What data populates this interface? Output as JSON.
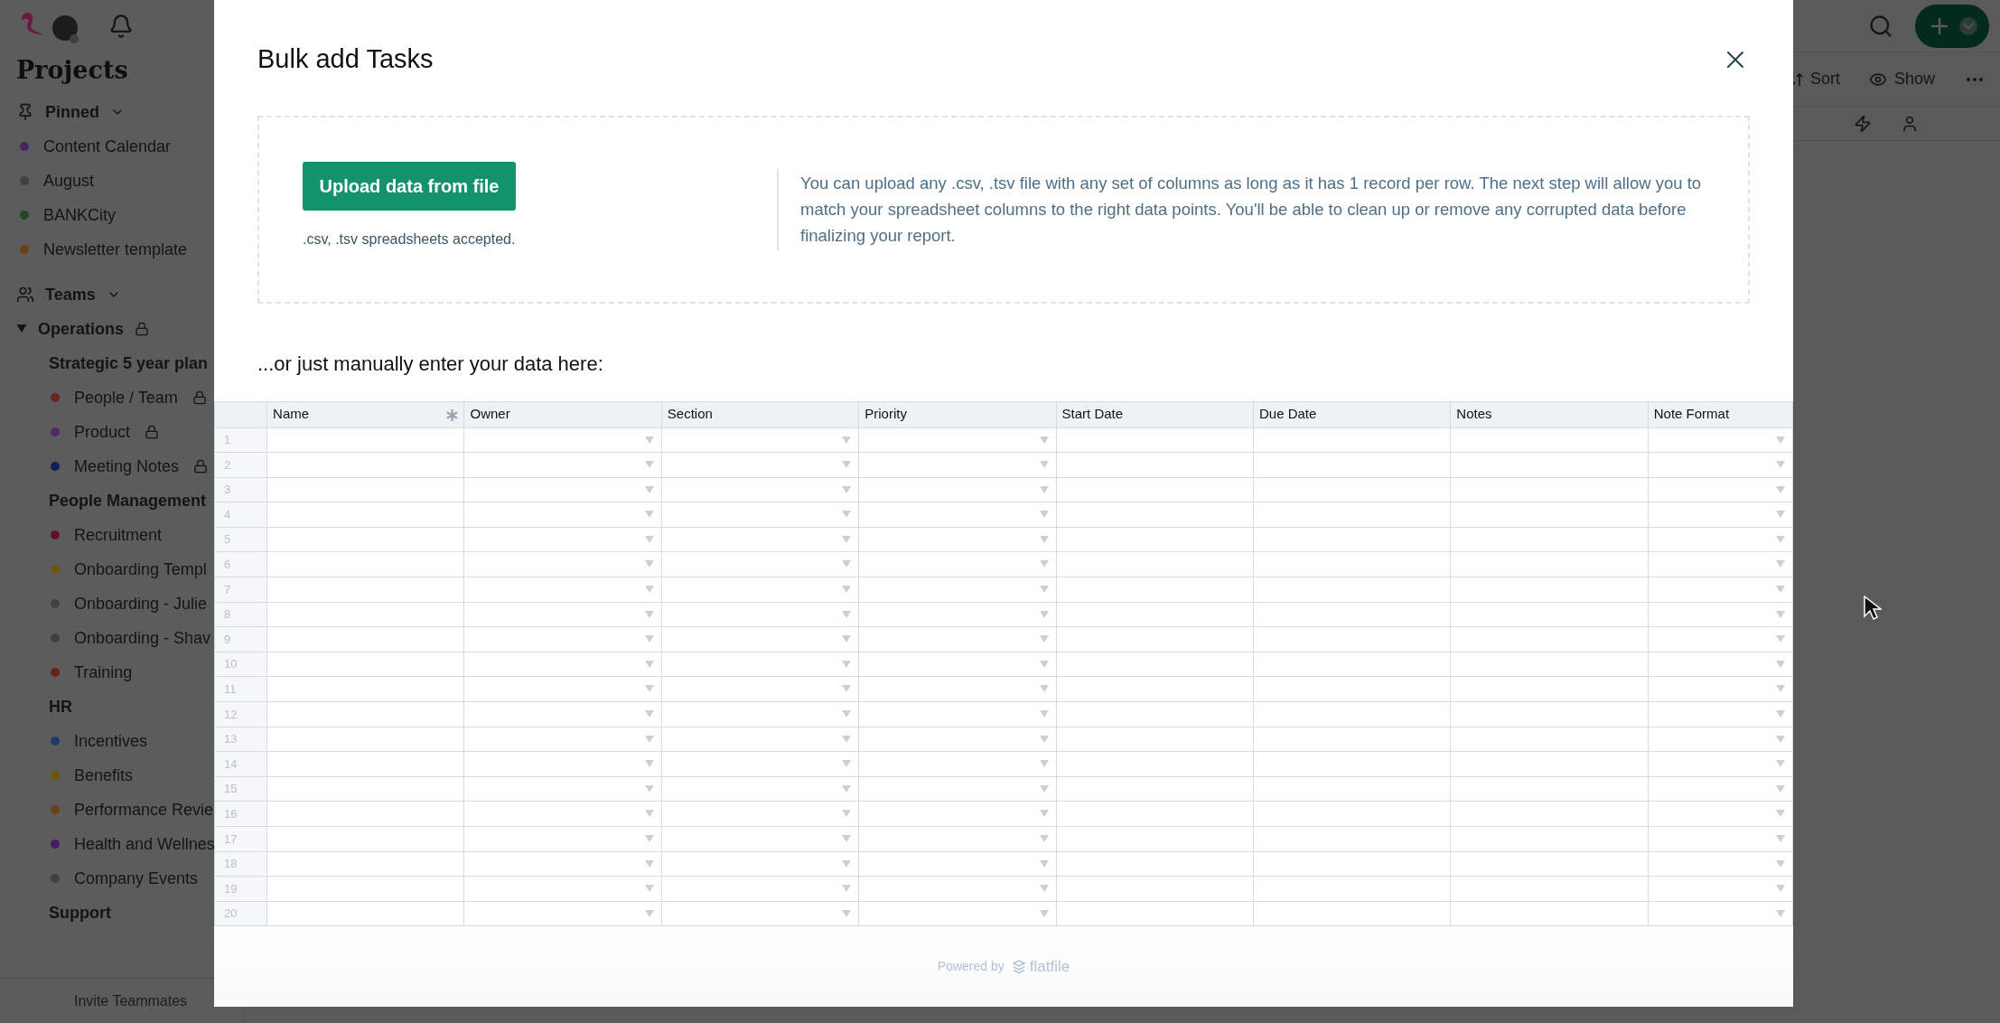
{
  "topbar": {
    "sort": "Sort",
    "show": "Show"
  },
  "sidebar": {
    "title": "Projects",
    "pinned": {
      "label": "Pinned",
      "items": [
        {
          "name": "Content Calendar",
          "color": "#4a2566"
        },
        {
          "name": "August",
          "color": "#404040"
        },
        {
          "name": "BANKCity",
          "color": "#1d4a22"
        },
        {
          "name": "Newsletter template",
          "color": "#6e4018"
        }
      ]
    },
    "teams": {
      "label": "Teams",
      "groups": [
        {
          "name": "Operations",
          "locked": true,
          "expanded": true,
          "children": [
            {
              "name": "Strategic 5 year plan",
              "children": [
                {
                  "name": "People / Team",
                  "color": "#6e2320",
                  "locked": true
                },
                {
                  "name": "Product",
                  "color": "#4f2a6a",
                  "locked": true
                },
                {
                  "name": "Meeting Notes",
                  "color": "#141c5c",
                  "locked": true
                }
              ]
            },
            {
              "name": "People Management",
              "children": [
                {
                  "name": "Recruitment",
                  "color": "#641128",
                  "locked": false
                },
                {
                  "name": "Onboarding Templ",
                  "color": "#6b5616"
                },
                {
                  "name": "Onboarding - Julie",
                  "color": "#404040"
                },
                {
                  "name": "Onboarding - Shav",
                  "color": "#404040"
                },
                {
                  "name": "Training",
                  "color": "#6b1f1a",
                  "locked": false
                }
              ]
            },
            {
              "name": "HR",
              "children": [
                {
                  "name": "Incentives",
                  "color": "#1c3d70",
                  "locked": false
                },
                {
                  "name": "Benefits",
                  "color": "#6e5508",
                  "locked": false
                },
                {
                  "name": "Performance Revie",
                  "color": "#6e4018"
                },
                {
                  "name": "Health and Wellnes",
                  "color": "#4a1a6e"
                },
                {
                  "name": "Company Events",
                  "color": "#404040",
                  "locked": false
                }
              ]
            },
            {
              "name": "Support"
            }
          ]
        }
      ]
    },
    "invite": "Invite Teammates"
  },
  "dialog": {
    "title": "Bulk add Tasks",
    "upload": {
      "button": "Upload data from file",
      "hint": ".csv, .tsv spreadsheets accepted.",
      "description": "You can upload any .csv, .tsv file with any set of columns as long as it has 1 record per row. The next step will allow you to match your spreadsheet columns to the right data points. You'll be able to clean up or remove any corrupted data before finalizing your report."
    },
    "manual_label": "...or just manually enter your data here:",
    "table": {
      "columns": [
        {
          "label": "Name",
          "kind": "text",
          "required": true
        },
        {
          "label": "Owner",
          "kind": "select",
          "required": false
        },
        {
          "label": "Section",
          "kind": "select",
          "required": false
        },
        {
          "label": "Priority",
          "kind": "select",
          "required": false
        },
        {
          "label": "Start Date",
          "kind": "text",
          "required": false
        },
        {
          "label": "Due Date",
          "kind": "text",
          "required": false
        },
        {
          "label": "Notes",
          "kind": "text",
          "required": false
        },
        {
          "label": "Note Format",
          "kind": "select",
          "required": false
        }
      ],
      "rows": [
        "1",
        "2",
        "3",
        "4",
        "5",
        "6",
        "7",
        "8",
        "9",
        "10",
        "11",
        "12",
        "13",
        "14",
        "15",
        "16",
        "17",
        "18",
        "19",
        "20"
      ]
    },
    "footer": {
      "powered_by": "Powered by",
      "brand": "flatfile"
    }
  }
}
